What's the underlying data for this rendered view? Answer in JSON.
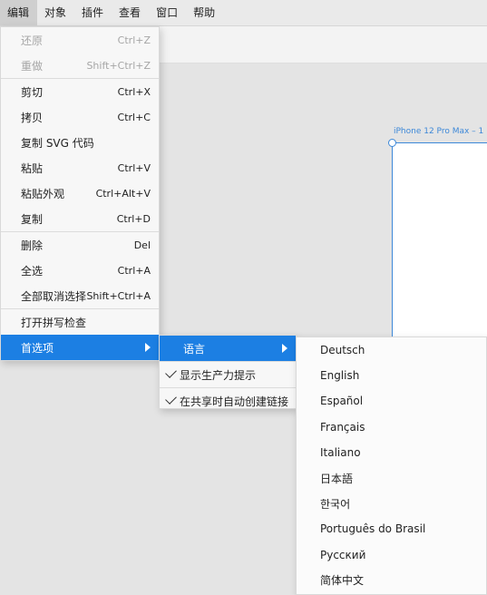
{
  "menubar": {
    "items": [
      "编辑",
      "对象",
      "插件",
      "查看",
      "窗口",
      "帮助"
    ]
  },
  "artboard": {
    "label": "iPhone 12 Pro Max – 1"
  },
  "edit_menu": {
    "items": [
      {
        "label": "还原",
        "shortcut": "Ctrl+Z",
        "disabled": true
      },
      {
        "label": "重做",
        "shortcut": "Shift+Ctrl+Z",
        "disabled": true
      },
      {
        "label": "剪切",
        "shortcut": "Ctrl+X"
      },
      {
        "label": "拷贝",
        "shortcut": "Ctrl+C"
      },
      {
        "label": "复制 SVG 代码",
        "shortcut": ""
      },
      {
        "label": "粘贴",
        "shortcut": "Ctrl+V"
      },
      {
        "label": "粘贴外观",
        "shortcut": "Ctrl+Alt+V"
      },
      {
        "label": "复制",
        "shortcut": "Ctrl+D"
      },
      {
        "label": "删除",
        "shortcut": "Del"
      },
      {
        "label": "全选",
        "shortcut": "Ctrl+A"
      },
      {
        "label": "全部取消选择",
        "shortcut": "Shift+Ctrl+A"
      },
      {
        "label": "打开拼写检查",
        "shortcut": ""
      },
      {
        "label": "首选项",
        "shortcut": ""
      }
    ]
  },
  "prefs_menu": {
    "items": [
      {
        "label": "语言"
      },
      {
        "label": "显示生产力提示",
        "checked": true
      },
      {
        "label": "在共享时自动创建链接",
        "checked": true
      }
    ]
  },
  "language_menu": {
    "items": [
      "Deutsch",
      "English",
      "Español",
      "Français",
      "Italiano",
      "日本語",
      "한국어",
      "Português do Brasil",
      "Русский",
      "简体中文"
    ]
  },
  "colors": {
    "accent": "#1c7fe3",
    "artboard_outline": "#3d88d8"
  }
}
